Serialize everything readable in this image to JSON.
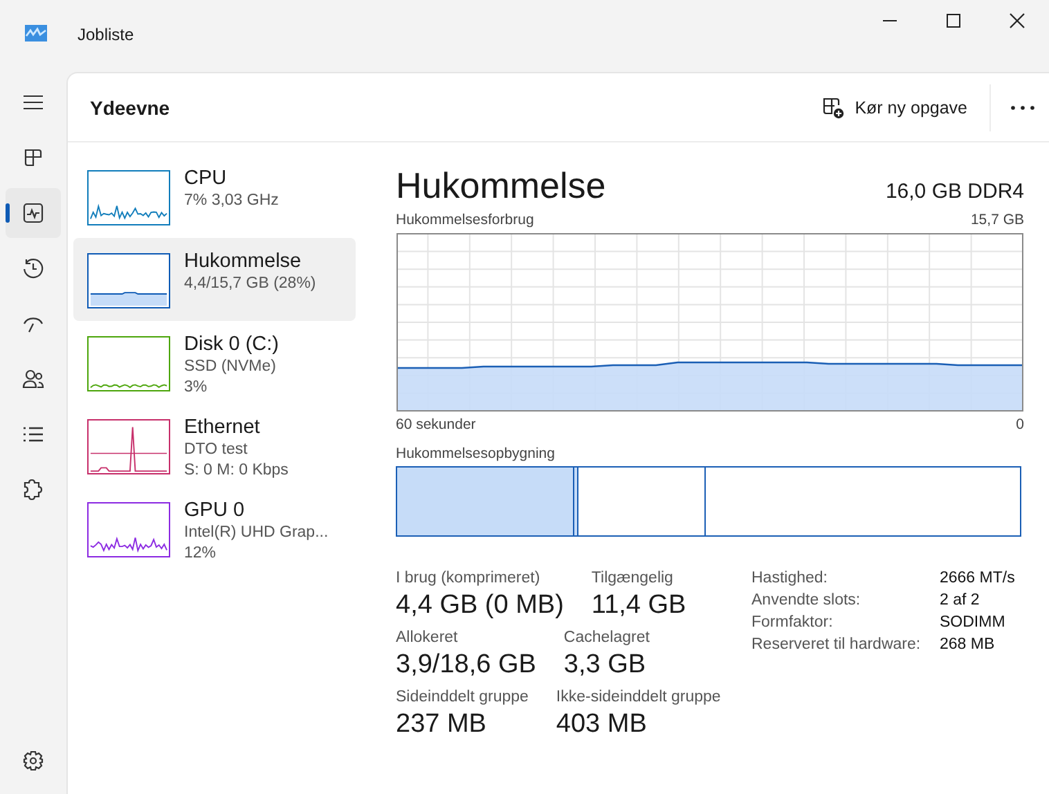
{
  "window": {
    "title": "Jobliste"
  },
  "nav": [
    {
      "selected": false
    },
    {
      "selected": false
    },
    {
      "selected": true
    },
    {
      "selected": false
    },
    {
      "selected": false
    },
    {
      "selected": false
    },
    {
      "selected": false
    },
    {
      "selected": false
    }
  ],
  "header": {
    "title": "Ydeevne",
    "run_task": "Kør ny opgave"
  },
  "devices": [
    {
      "name": "CPU",
      "lines": [
        "7% 3,03 GHz"
      ],
      "color": "#117dbb",
      "kind": "spiky",
      "selected": false
    },
    {
      "name": "Hukommelse",
      "lines": [
        "4,4/15,7 GB (28%)"
      ],
      "color": "#0f5bb5",
      "kind": "memory",
      "selected": true
    },
    {
      "name": "Disk 0 (C:)",
      "lines": [
        "SSD (NVMe)",
        "3%"
      ],
      "color": "#4da60c",
      "kind": "flat",
      "selected": false
    },
    {
      "name": "Ethernet",
      "lines": [
        "DTO test",
        "S: 0 M: 0 Kbps"
      ],
      "color": "#c7306b",
      "kind": "peak",
      "selected": false
    },
    {
      "name": "GPU 0",
      "lines": [
        "Intel(R) UHD Grap...",
        "12%"
      ],
      "color": "#8c2be2",
      "kind": "spiky",
      "selected": false
    }
  ],
  "detail": {
    "title": "Hukommelse",
    "subtitle": "16,0 GB DDR4",
    "usage_chart": {
      "label": "Hukommelsesforbrug",
      "max_label": "15,7 GB",
      "time_label": "60 sekunder",
      "end_label": "0"
    },
    "composition": {
      "label": "Hukommelsesopbygning"
    },
    "stats": [
      [
        {
          "label": "I brug (komprimeret)",
          "value": "4,4 GB (0 MB)"
        },
        {
          "label": "Tilgængelig",
          "value": "11,4 GB"
        }
      ],
      [
        {
          "label": "Allokeret",
          "value": "3,9/18,6 GB"
        },
        {
          "label": "Cachelagret",
          "value": "3,3 GB"
        }
      ],
      [
        {
          "label": "Sideinddelt gruppe",
          "value": "237 MB"
        },
        {
          "label": "Ikke-sideinddelt gruppe",
          "value": "403 MB"
        }
      ]
    ],
    "specs": [
      {
        "label": "Hastighed:",
        "value": "2666 MT/s"
      },
      {
        "label": "Anvendte slots:",
        "value": "2 af 2"
      },
      {
        "label": "Formfaktor:",
        "value": "SODIMM"
      },
      {
        "label": "Reserveret til hardware:",
        "value": "268 MB"
      }
    ]
  }
}
